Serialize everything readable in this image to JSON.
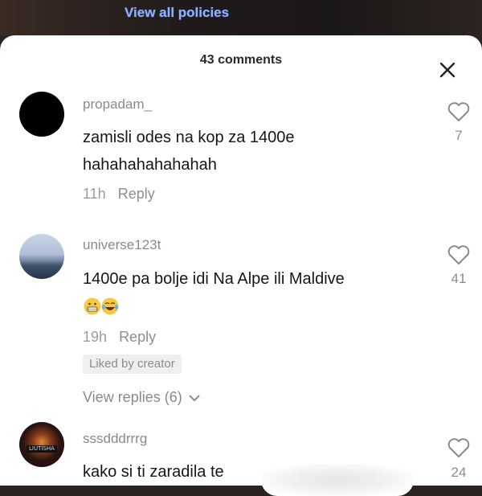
{
  "header": {
    "policies_link": "View all policies"
  },
  "sheet": {
    "title": "43 comments"
  },
  "comments": [
    {
      "username": "propadam_",
      "lines": [
        "zamisli odes na kop za 1400e",
        "hahahahahahahah"
      ],
      "time": "11h",
      "reply": "Reply",
      "likes": "7"
    },
    {
      "username": "universe123t",
      "lines": [
        "1400e pa bolje idi Na Alpe ili Maldive"
      ],
      "emoji": [
        "grimacing-emoji",
        "laughing-tears-emoji"
      ],
      "time": "19h",
      "reply": "Reply",
      "liked_by": "Liked by creator",
      "view_replies": "View replies (6)",
      "likes": "41"
    },
    {
      "username": "sssdddrrrg",
      "avatar_badge": "LIUTISHA",
      "lines": [
        "kako si ti zaradila te"
      ],
      "likes": "24"
    }
  ],
  "icons": {
    "close": "close-icon",
    "heart": "heart-outline-icon",
    "chevron": "chevron-down-icon"
  },
  "colors": {
    "link_blue": "#8fb1ff",
    "text_dark": "#161616",
    "text_muted": "#8a8a8a",
    "sheet_bg": "#ffffff"
  }
}
